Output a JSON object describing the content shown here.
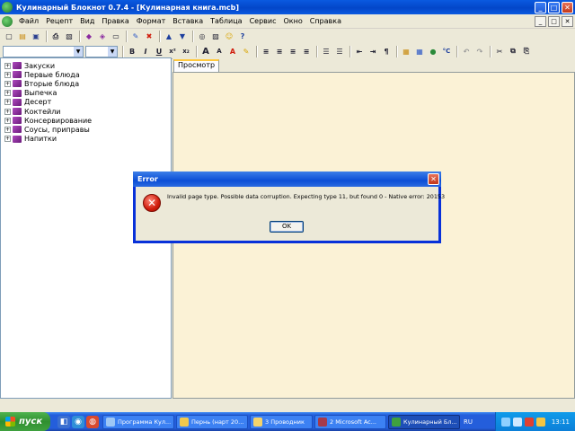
{
  "window": {
    "title": "Кулинарный Блокнот 0.7.4 - [Кулинарная книга.mcb]",
    "min_label": "_",
    "max_label": "□",
    "close_label": "✕"
  },
  "menu": {
    "items": [
      "Файл",
      "Рецепт",
      "Вид",
      "Правка",
      "Формат",
      "Вставка",
      "Таблица",
      "Сервис",
      "Окно",
      "Справка"
    ],
    "child_min": "_",
    "child_max": "□",
    "child_close": "✕"
  },
  "toolbar1": {
    "icons": [
      "new-icon",
      "open-icon",
      "save-icon",
      "print-icon",
      "print-preview-icon",
      "recipe-book-icon",
      "book-icon",
      "page-icon",
      "edit-icon",
      "delete-icon",
      "up-arrow-icon",
      "down-arrow-icon",
      "find-icon",
      "image-icon",
      "smiley-icon",
      "help-icon"
    ],
    "glyphs": [
      "▢",
      "▤",
      "▣",
      "⎙",
      "▧",
      "◆",
      "◈",
      "▭",
      "✎",
      "✖",
      "▲",
      "▼",
      "◎",
      "▨",
      "☺",
      "?"
    ]
  },
  "toolbar2": {
    "font_name": "",
    "font_size": "",
    "glyphs": [
      "B",
      "I",
      "U",
      "x²",
      "x₂",
      "A",
      "A",
      "A",
      "✎",
      "≡",
      "≡",
      "≡",
      "≡",
      "☰",
      "☰",
      "⇤",
      "⇥",
      "¶",
      "▦",
      "▦",
      "●",
      "°C",
      "↶",
      "↷",
      "✂",
      "⧉",
      "⎘"
    ]
  },
  "tree": {
    "items": [
      "Закуски",
      "Первые блюда",
      "Вторые блюда",
      "Выпечка",
      "Десерт",
      "Коктейли",
      "Консервирование",
      "Соусы, приправы",
      "Напитки"
    ],
    "expander": "+"
  },
  "preview": {
    "tab_label": "Просмотр"
  },
  "dialog": {
    "title": "Error",
    "close_label": "✕",
    "icon_glyph": "✕",
    "message": "Invalid page type. Possible data corruption. Expecting type 11, but found 0 - Native error: 20153",
    "ok_label": "OK"
  },
  "taskbar": {
    "start_label": "пуск",
    "quick_glyphs": [
      "◧",
      "◉",
      "◍"
    ],
    "tasks": [
      {
        "label": "Программа Кул...",
        "active": false
      },
      {
        "label": "Пернь (нарт 20...",
        "active": false
      },
      {
        "label": "3 Проводник",
        "active": false
      },
      {
        "label": "2 Microsoft Ac...",
        "active": false
      },
      {
        "label": "Кулинарный Бл...",
        "active": true
      }
    ],
    "language": "RU",
    "clock": "13:11"
  },
  "colors": {
    "titlebar_blue": "#0a5ae0",
    "preview_background": "#fbf2d6",
    "error_red": "#d01c0c",
    "start_green": "#3fa13f"
  }
}
